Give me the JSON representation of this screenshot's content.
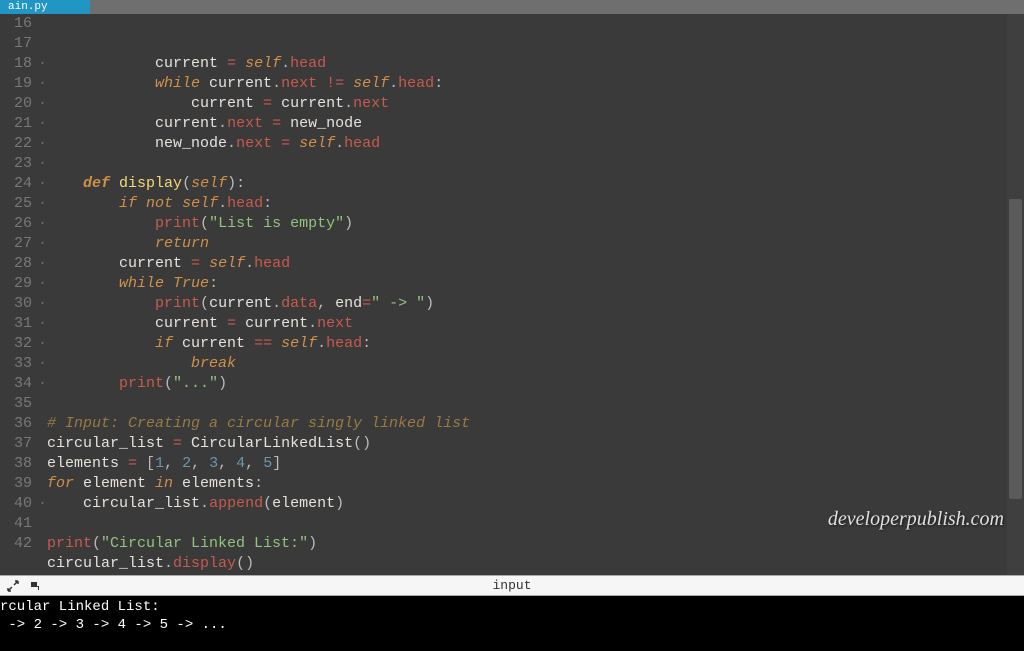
{
  "tab": {
    "filename": "ain.py"
  },
  "line_start": 16,
  "line_end": 42,
  "code_lines": [
    [
      [
        4,
        ""
      ],
      [
        "sp",
        "            "
      ],
      [
        "ident",
        "current "
      ],
      [
        "op",
        "="
      ],
      [
        "ident",
        " "
      ],
      [
        "selfc",
        "self"
      ],
      [
        "pun",
        "."
      ],
      [
        "attr",
        "head"
      ]
    ],
    [
      [
        4,
        ""
      ],
      [
        "sp",
        "            "
      ],
      [
        "kw",
        "while"
      ],
      [
        "ident",
        " current"
      ],
      [
        "pun",
        "."
      ],
      [
        "attr",
        "next"
      ],
      [
        "ident",
        " "
      ],
      [
        "op",
        "!="
      ],
      [
        "ident",
        " "
      ],
      [
        "selfc",
        "self"
      ],
      [
        "pun",
        "."
      ],
      [
        "attr",
        "head"
      ],
      [
        "pun",
        ":"
      ]
    ],
    [
      [
        5,
        ""
      ],
      [
        "sp",
        "                "
      ],
      [
        "ident",
        "current "
      ],
      [
        "op",
        "="
      ],
      [
        "ident",
        " current"
      ],
      [
        "pun",
        "."
      ],
      [
        "attr",
        "next"
      ]
    ],
    [
      [
        4,
        ""
      ],
      [
        "sp",
        "            "
      ],
      [
        "ident",
        "current"
      ],
      [
        "pun",
        "."
      ],
      [
        "attr",
        "next"
      ],
      [
        "ident",
        " "
      ],
      [
        "op",
        "="
      ],
      [
        "ident",
        " new_node"
      ]
    ],
    [
      [
        4,
        ""
      ],
      [
        "sp",
        "            "
      ],
      [
        "ident",
        "new_node"
      ],
      [
        "pun",
        "."
      ],
      [
        "attr",
        "next"
      ],
      [
        "ident",
        " "
      ],
      [
        "op",
        "="
      ],
      [
        "ident",
        " "
      ],
      [
        "selfc",
        "self"
      ],
      [
        "pun",
        "."
      ],
      [
        "attr",
        "head"
      ]
    ],
    [
      [
        1,
        ""
      ]
    ],
    [
      [
        1,
        ""
      ],
      [
        "sp",
        "    "
      ],
      [
        "kwbold",
        "def"
      ],
      [
        "ident",
        " "
      ],
      [
        "def",
        "display"
      ],
      [
        "pun",
        "("
      ],
      [
        "selfc",
        "self"
      ],
      [
        "pun",
        "):"
      ]
    ],
    [
      [
        2,
        ""
      ],
      [
        "sp",
        "        "
      ],
      [
        "kw",
        "if"
      ],
      [
        "ident",
        " "
      ],
      [
        "kw",
        "not"
      ],
      [
        "ident",
        " "
      ],
      [
        "selfc",
        "self"
      ],
      [
        "pun",
        "."
      ],
      [
        "attr",
        "head"
      ],
      [
        "pun",
        ":"
      ]
    ],
    [
      [
        3,
        ""
      ],
      [
        "sp",
        "            "
      ],
      [
        "builtin",
        "print"
      ],
      [
        "pun",
        "("
      ],
      [
        "str",
        "\"List is empty\""
      ],
      [
        "pun",
        ")"
      ]
    ],
    [
      [
        3,
        ""
      ],
      [
        "sp",
        "            "
      ],
      [
        "kw",
        "return"
      ]
    ],
    [
      [
        2,
        ""
      ],
      [
        "sp",
        "        "
      ],
      [
        "ident",
        "current "
      ],
      [
        "op",
        "="
      ],
      [
        "ident",
        " "
      ],
      [
        "selfc",
        "self"
      ],
      [
        "pun",
        "."
      ],
      [
        "attr",
        "head"
      ]
    ],
    [
      [
        2,
        ""
      ],
      [
        "sp",
        "        "
      ],
      [
        "kw",
        "while"
      ],
      [
        "ident",
        " "
      ],
      [
        "kw",
        "True"
      ],
      [
        "pun",
        ":"
      ]
    ],
    [
      [
        3,
        ""
      ],
      [
        "sp",
        "            "
      ],
      [
        "builtin",
        "print"
      ],
      [
        "pun",
        "("
      ],
      [
        "ident",
        "current"
      ],
      [
        "pun",
        "."
      ],
      [
        "attr",
        "data"
      ],
      [
        "pun",
        ", "
      ],
      [
        "ident",
        "end"
      ],
      [
        "op",
        "="
      ],
      [
        "str",
        "\" -> \""
      ],
      [
        "pun",
        ")"
      ]
    ],
    [
      [
        3,
        ""
      ],
      [
        "sp",
        "            "
      ],
      [
        "ident",
        "current "
      ],
      [
        "op",
        "="
      ],
      [
        "ident",
        " current"
      ],
      [
        "pun",
        "."
      ],
      [
        "attr",
        "next"
      ]
    ],
    [
      [
        3,
        ""
      ],
      [
        "sp",
        "            "
      ],
      [
        "kw",
        "if"
      ],
      [
        "ident",
        " current "
      ],
      [
        "op",
        "=="
      ],
      [
        "ident",
        " "
      ],
      [
        "selfc",
        "self"
      ],
      [
        "pun",
        "."
      ],
      [
        "attr",
        "head"
      ],
      [
        "pun",
        ":"
      ]
    ],
    [
      [
        4,
        ""
      ],
      [
        "sp",
        "                "
      ],
      [
        "kw",
        "break"
      ]
    ],
    [
      [
        2,
        ""
      ],
      [
        "sp",
        "        "
      ],
      [
        "builtin",
        "print"
      ],
      [
        "pun",
        "("
      ],
      [
        "str",
        "\"...\""
      ],
      [
        "pun",
        ")"
      ]
    ],
    [
      [
        0,
        ""
      ]
    ],
    [
      [
        "comment",
        "# Input: Creating a circular singly linked list"
      ]
    ],
    [
      [
        "ident",
        "circular_list "
      ],
      [
        "op",
        "="
      ],
      [
        "ident",
        " CircularLinkedList"
      ],
      [
        "pun",
        "()"
      ]
    ],
    [
      [
        "ident",
        "elements "
      ],
      [
        "op",
        "="
      ],
      [
        "ident",
        " "
      ],
      [
        "pun",
        "["
      ],
      [
        "num",
        "1"
      ],
      [
        "pun",
        ", "
      ],
      [
        "num",
        "2"
      ],
      [
        "pun",
        ", "
      ],
      [
        "num",
        "3"
      ],
      [
        "pun",
        ", "
      ],
      [
        "num",
        "4"
      ],
      [
        "pun",
        ", "
      ],
      [
        "num",
        "5"
      ],
      [
        "pun",
        "]"
      ]
    ],
    [
      [
        "kw",
        "for"
      ],
      [
        "ident",
        " element "
      ],
      [
        "kw",
        "in"
      ],
      [
        "ident",
        " elements"
      ],
      [
        "pun",
        ":"
      ]
    ],
    [
      [
        1,
        ""
      ],
      [
        "sp",
        "    "
      ],
      [
        "ident",
        "circular_list"
      ],
      [
        "pun",
        "."
      ],
      [
        "attr",
        "append"
      ],
      [
        "pun",
        "("
      ],
      [
        "ident",
        "element"
      ],
      [
        "pun",
        ")"
      ]
    ],
    [
      [
        0,
        ""
      ]
    ],
    [
      [
        "builtin",
        "print"
      ],
      [
        "pun",
        "("
      ],
      [
        "str",
        "\"Circular Linked List:\""
      ],
      [
        "pun",
        ")"
      ]
    ],
    [
      [
        "ident",
        "circular_list"
      ],
      [
        "pun",
        "."
      ],
      [
        "attr",
        "display"
      ],
      [
        "pun",
        "()"
      ]
    ],
    [
      [
        0,
        ""
      ]
    ]
  ],
  "toolbar": {
    "center_label": "input"
  },
  "terminal_lines": [
    "rcular Linked List:",
    " -> 2 -> 3 -> 4 -> 5 -> ..."
  ],
  "watermark": "developerpublish.com",
  "colors": {
    "background": "#3a3a3a",
    "keyword": "#d09049",
    "definition": "#f4d87a",
    "attribute": "#c85a4d",
    "string": "#93c37e",
    "number": "#6b97b2",
    "comment": "#9a7a44"
  }
}
